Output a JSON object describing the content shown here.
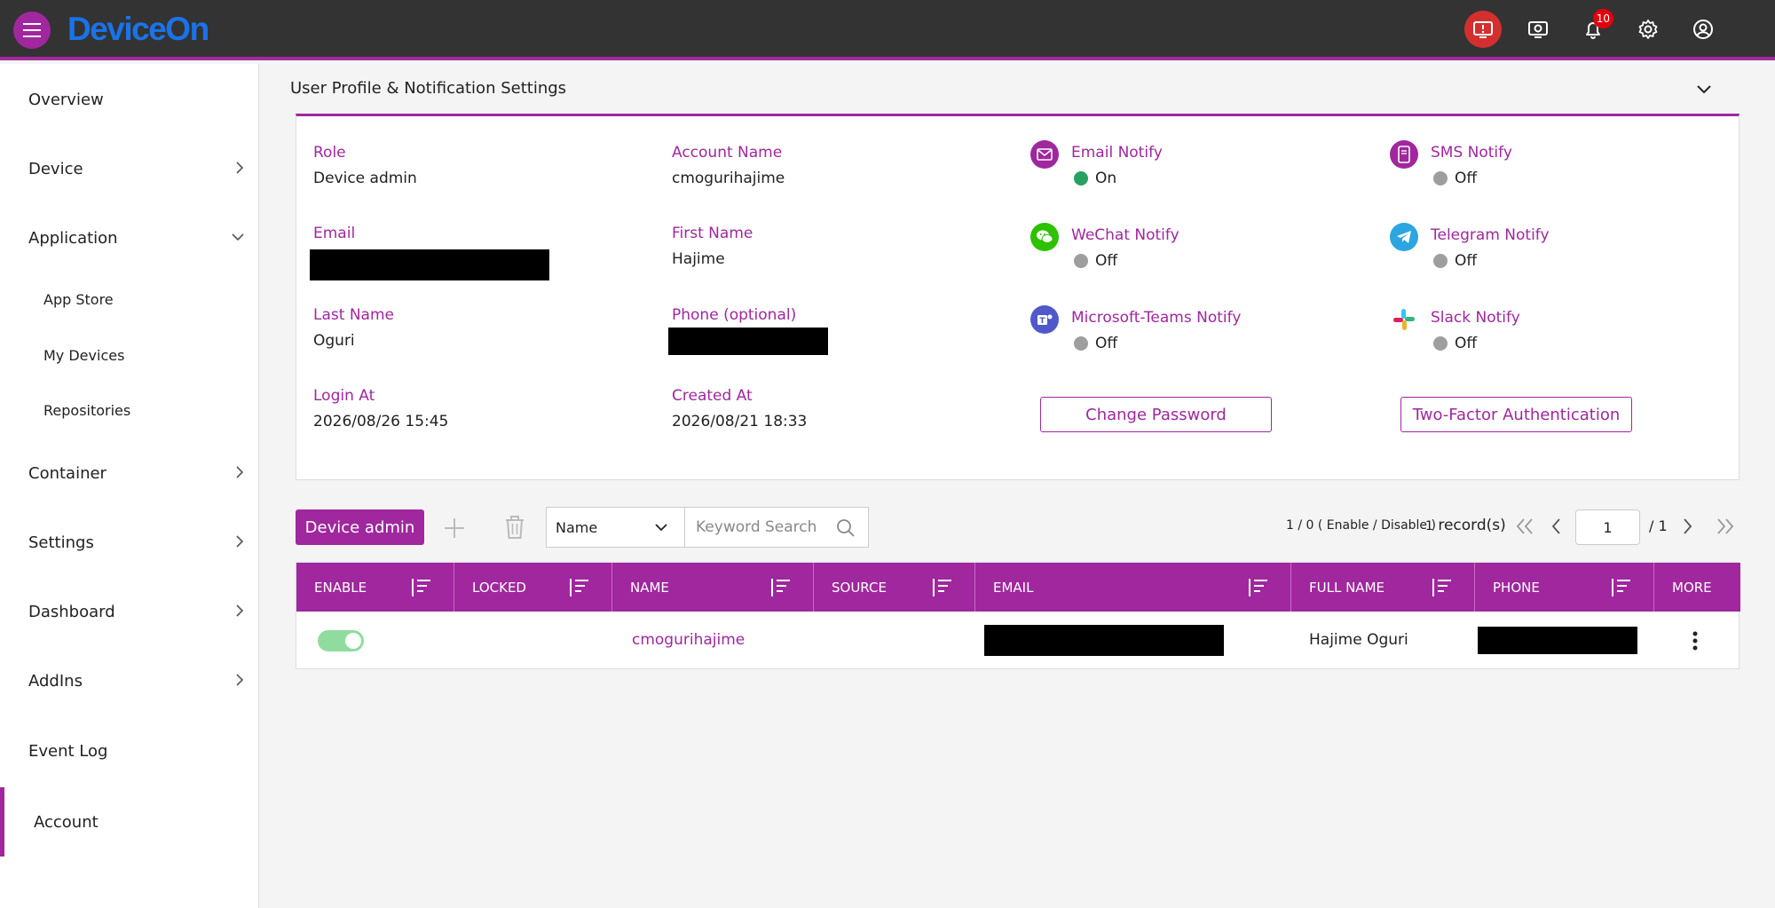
{
  "app": {
    "name": "DeviceOn"
  },
  "header": {
    "icons": [
      "alert-monitor-icon",
      "remote-desktop-icon",
      "bell-icon",
      "gear-icon",
      "user-icon"
    ],
    "notification_count": "10"
  },
  "sidebar": {
    "items": [
      {
        "label": "Overview"
      },
      {
        "label": "Device"
      },
      {
        "label": "Application"
      },
      {
        "label": "App Store"
      },
      {
        "label": "My Devices"
      },
      {
        "label": "Repositories"
      },
      {
        "label": "Container"
      },
      {
        "label": "Settings"
      },
      {
        "label": "Dashboard"
      },
      {
        "label": "AddIns"
      },
      {
        "label": "Event Log"
      },
      {
        "label": "Account"
      }
    ]
  },
  "profile": {
    "title": "User Profile & Notification Settings",
    "fields": {
      "role": {
        "label": "Role",
        "value": "Device admin"
      },
      "account_name": {
        "label": "Account Name",
        "value": "cmogurihajime"
      },
      "email": {
        "label": "Email"
      },
      "first_name": {
        "label": "First Name",
        "value": "Hajime"
      },
      "last_name": {
        "label": "Last Name",
        "value": "Oguri"
      },
      "phone": {
        "label": "Phone (optional)"
      },
      "login_at": {
        "label": "Login At",
        "value": "2026/08/26 15:45"
      },
      "created_at": {
        "label": "Created At",
        "value": "2026/08/21 18:33"
      }
    },
    "notify": {
      "email": {
        "label": "Email Notify",
        "status": "On",
        "color": "#a0279e"
      },
      "sms": {
        "label": "SMS Notify",
        "status": "Off",
        "color": "#a0279e"
      },
      "wechat": {
        "label": "WeChat Notify",
        "status": "Off",
        "color": "#2dc100"
      },
      "telegram": {
        "label": "Telegram Notify",
        "status": "Off",
        "color": "#2ca5e0"
      },
      "teams": {
        "label": "Microsoft-Teams Notify",
        "status": "Off",
        "color": "#5059c9"
      },
      "slack": {
        "label": "Slack Notify",
        "status": "Off",
        "color": "#e01e5a"
      }
    },
    "buttons": {
      "change_password": "Change Password",
      "two_factor": "Two-Factor Authentication"
    }
  },
  "toolbar": {
    "role_button": "Device admin",
    "filter_select": "Name",
    "search_placeholder": "Keyword Search",
    "summary": "1 / 0 ( Enable / Disable )",
    "record_count": "1",
    "record_label": "record(s)",
    "page_current": "1",
    "page_total": "/ 1"
  },
  "table": {
    "headers": [
      "ENABLE",
      "LOCKED",
      "NAME",
      "SOURCE",
      "EMAIL",
      "FULL NAME",
      "PHONE",
      "MORE"
    ],
    "rows": [
      {
        "enabled": true,
        "locked": "",
        "name": "cmogurihajime",
        "source": "",
        "full_name": "Hajime Oguri"
      }
    ]
  },
  "colors": {
    "accent": "#a0279e",
    "topbar": "#333333",
    "logo": "#1a73e8",
    "on": "#27a061",
    "off": "#9e9e9e"
  }
}
